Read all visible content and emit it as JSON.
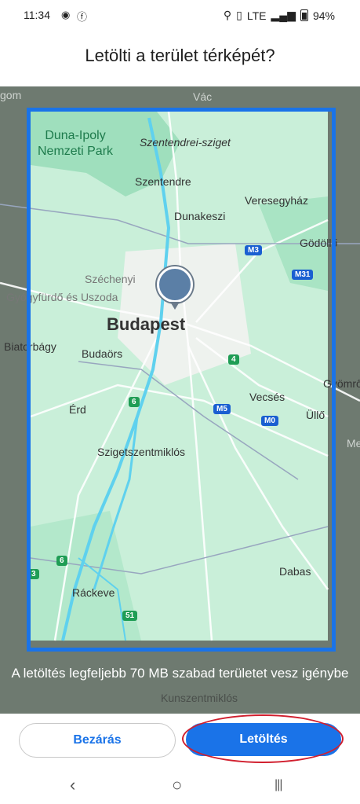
{
  "status_bar": {
    "time": "11:34",
    "network": "LTE",
    "battery": "94%"
  },
  "header": {
    "title": "Letölti a terület térképét?"
  },
  "map": {
    "labels": {
      "gom": "gom",
      "vac": "Vác",
      "park": "Duna-Ipoly\nNemzeti Park",
      "sziget": "Szentendrei-sziget",
      "szentendre": "Szentendre",
      "veresegyhaz": "Veresegyház",
      "dunakeszi": "Dunakeszi",
      "godollo": "Gödöllő",
      "szechenyi": "Széchenyi",
      "gyogyfurdo": "Gyógyfürdő és Uszoda",
      "budapest": "Budapest",
      "biatorbagy": "Biatorbágy",
      "budaors": "Budaörs",
      "vecses": "Vecsés",
      "gyomro": "Gyömrő",
      "erd": "Érd",
      "ullo": "Üllő",
      "me": "Me",
      "szigetszentmiklos": "Szigetszentmiklós",
      "dabas": "Dabas",
      "rackeve": "Ráckeve",
      "kunszentmiklos": "Kunszentmiklós"
    },
    "shields": {
      "m3": "M3",
      "m31": "M31",
      "r4": "4",
      "m5": "M5",
      "m0": "M0",
      "r6a": "6",
      "r6b": "6",
      "r51": "51",
      "r3": "3"
    }
  },
  "notice": "A letöltés legfeljebb 70 MB szabad területet vesz igénybe",
  "buttons": {
    "close": "Bezárás",
    "download": "Letöltés"
  },
  "nav": {
    "back": "‹",
    "home": "○",
    "recents": "|||"
  }
}
